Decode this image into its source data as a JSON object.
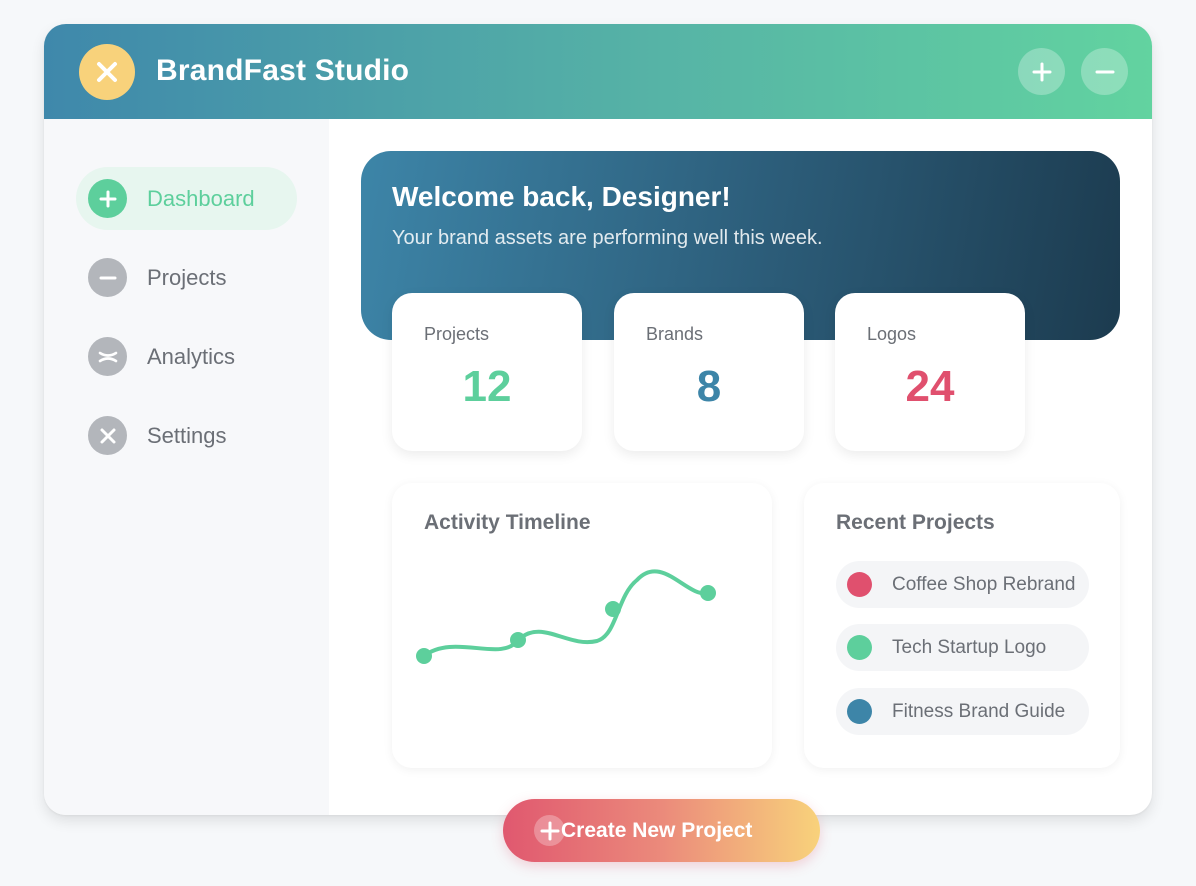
{
  "app": {
    "title": "BrandFast Studio",
    "logo_icon": "close-icon",
    "window_controls": [
      {
        "icon": "plus-icon"
      },
      {
        "icon": "minus-icon"
      }
    ]
  },
  "sidebar": {
    "items": [
      {
        "label": "Dashboard",
        "icon": "plus-icon",
        "active": true
      },
      {
        "label": "Projects",
        "icon": "minus-icon",
        "active": false
      },
      {
        "label": "Analytics",
        "icon": "scissors-icon",
        "active": false
      },
      {
        "label": "Settings",
        "icon": "close-icon",
        "active": false
      }
    ]
  },
  "welcome": {
    "title": "Welcome back, Designer!",
    "subtitle": "Your brand assets are performing well this week."
  },
  "stats": [
    {
      "label": "Projects",
      "value": "12",
      "color": "#5dcf9c"
    },
    {
      "label": "Brands",
      "value": "8",
      "color": "#3d85a8"
    },
    {
      "label": "Logos",
      "value": "24",
      "color": "#e0506e"
    }
  ],
  "activity": {
    "title": "Activity Timeline"
  },
  "recent": {
    "title": "Recent Projects",
    "items": [
      {
        "label": "Coffee Shop Rebrand",
        "color": "#e0506e"
      },
      {
        "label": "Tech Startup Logo",
        "color": "#5dcf9c"
      },
      {
        "label": "Fitness Brand Guide",
        "color": "#3d85a8"
      }
    ]
  },
  "cta": {
    "label": "Create New Project",
    "icon": "plus-icon"
  },
  "colors": {
    "accent_green": "#5dcf9c",
    "accent_blue": "#3d85a8",
    "accent_red": "#e0506e",
    "accent_yellow": "#f8d27b"
  }
}
